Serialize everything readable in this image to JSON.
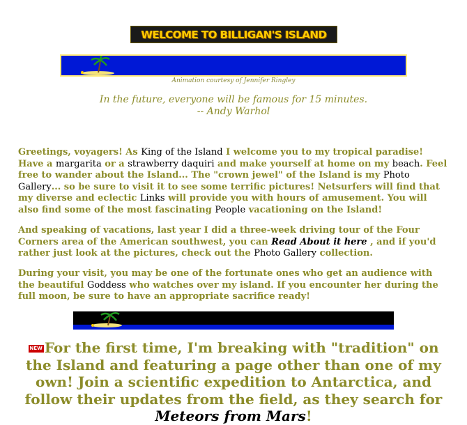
{
  "header": {
    "banner_text": "WELCOME TO BILLIGAN'S ISLAND",
    "credit": "Animation courtesy of Jennifer Ringley"
  },
  "quote": {
    "line1": "In the future, everyone will be famous for 15 minutes.",
    "line2": "-- Andy Warhol"
  },
  "para1": {
    "t1": "Greetings, voyagers! As ",
    "link_king": "King of the Island",
    "t2": " I welcome you to my tropical paradise! Have a ",
    "link_margarita": "margarita",
    "t3": " or a ",
    "link_daquiri": "strawberry daquiri",
    "t4": " and make yourself at home on my ",
    "link_beach": "beach",
    "t5": ". Feel free to wander about the Island... The \"crown jewel\" of the Island is my ",
    "link_gallery": "Photo Gallery",
    "t6": "... so be sure to visit it to see some terrific pictures! Netsurfers will find that my diverse and eclectic ",
    "link_links": "Links",
    "t7": " will provide you with hours of amusement. You will also find some of the most fascinating ",
    "link_people": "People",
    "t8": " vacationing on the Island!"
  },
  "para2": {
    "t1": "And speaking of vacations, last year I did a three-week driving tour of the Four Corners area of the American southwest, you can ",
    "link_read": "Read About it here",
    "t2": " , and if you'd rather just look at the pictures, check out the ",
    "link_gallery": "Photo Gallery",
    "t3": " collection."
  },
  "para3": {
    "t1": "During your visit, you may be one of the fortunate ones who get an audience with the beautiful ",
    "link_goddess": "Goddess",
    "t2": " who watches over my island. If you encounter her during the full moon, be sure to have an appropriate sacrifice ready!"
  },
  "announcement": {
    "badge": "NEW",
    "t1": "For the first time, I'm breaking with \"tradition\" on the Island and featuring a page other than one of my own! Join a scientific expedition to Antarctica, and follow their updates from the field, as they search for ",
    "link_meteors": "Meteors from Mars",
    "t2": "!"
  },
  "colors": {
    "text_olive": "#8c8c2a",
    "link": "#000000",
    "banner_bg": "#1a1a1a",
    "banner_text": "#ffcc00",
    "ocean_blue": "#0018d6",
    "new_badge": "#cc0000"
  }
}
